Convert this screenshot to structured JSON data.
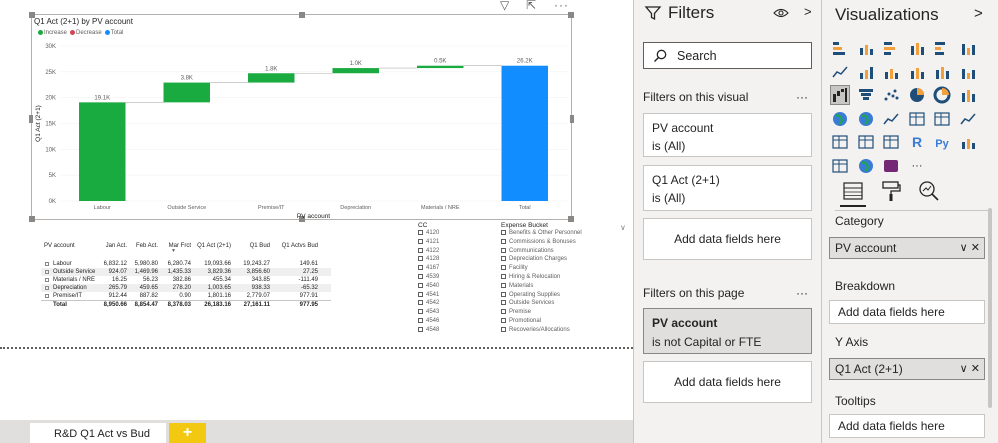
{
  "chart_data": {
    "type": "waterfall",
    "title": "Q1 Act (2+1) by PV account",
    "xlabel": "PV account",
    "ylabel": "Q1 Act (2+1)",
    "ylim": [
      0,
      30000
    ],
    "yticks": [
      "0K",
      "5K",
      "10K",
      "15K",
      "20K",
      "25K",
      "30K"
    ],
    "categories": [
      "Labour",
      "Outside Service",
      "Premise/IT",
      "Depreciation",
      "Materials / NRE",
      "Total"
    ],
    "values": [
      19093.66,
      3829.36,
      1801.16,
      1003.65,
      455.34,
      26183.16
    ],
    "data_labels": [
      "19.1K",
      "3.8K",
      "1.8K",
      "1.0K",
      "0.5K",
      "26.2K"
    ],
    "legend": [
      {
        "name": "Increase",
        "color": "#1aab40"
      },
      {
        "name": "Decrease",
        "color": "#d64554"
      },
      {
        "name": "Total",
        "color": "#118dff"
      }
    ],
    "legend_position": "top-left",
    "grid": true
  },
  "table": {
    "headers": [
      "PV account",
      "Jan Act.",
      "Feb Act.",
      "Mar Frct",
      "Q1 Act (2+1)",
      "Q1 Bud",
      "Q1 Actvs Bud"
    ],
    "rows": [
      {
        "label": "Labour",
        "cells": [
          "6,832.12",
          "5,980.80",
          "6,280.74",
          "19,093.66",
          "19,243.27",
          "149.61"
        ]
      },
      {
        "label": "Outside Service",
        "cells": [
          "924.07",
          "1,469.96",
          "1,435.33",
          "3,829.36",
          "3,856.60",
          "27.25"
        ]
      },
      {
        "label": "Materials / NRE",
        "cells": [
          "16.25",
          "56.23",
          "382.86",
          "455.34",
          "343.85",
          "-111.49"
        ]
      },
      {
        "label": "Depreciation",
        "cells": [
          "265.79",
          "459.65",
          "278.20",
          "1,003.65",
          "938.33",
          "-65.32"
        ]
      },
      {
        "label": "Premise/IT",
        "cells": [
          "912.44",
          "887.82",
          "0.90",
          "1,801.16",
          "2,779.07",
          "977.91"
        ]
      }
    ],
    "total": {
      "label": "Total",
      "cells": [
        "8,950.66",
        "8,854.47",
        "8,378.03",
        "26,183.16",
        "27,161.11",
        "977.95"
      ]
    }
  },
  "slicer_cc": {
    "title": "CC",
    "items": [
      "4120",
      "4121",
      "4122",
      "4128",
      "4167",
      "4539",
      "4540",
      "4541",
      "4542",
      "4543",
      "4546",
      "4548"
    ]
  },
  "slicer_expense": {
    "title": "Expense Bucket",
    "items": [
      "Benefits & Other Personnel",
      "Commissions & Bonuses",
      "Communications",
      "Depreciation Charges",
      "Facility",
      "Hiring & Relocation",
      "Materials",
      "Operating Supplies",
      "Outside Services",
      "Premise",
      "Promotional",
      "Recoveries/Allocations"
    ]
  },
  "tabs": {
    "page_tab": "R&D Q1 Act vs Bud",
    "add_label": "+"
  },
  "filters": {
    "title": "Filters",
    "search_placeholder": "Search",
    "section_visual": "Filters on this visual",
    "section_page": "Filters on this page",
    "more": "···",
    "visual_filters": [
      {
        "name": "PV account",
        "value": "is (All)"
      },
      {
        "name": "Q1 Act (2+1)",
        "value": "is (All)"
      }
    ],
    "page_filters": [
      {
        "name": "PV account",
        "value": "is not Capital or FTE"
      }
    ],
    "add_fields": "Add data fields here"
  },
  "visualizations": {
    "title": "Visualizations",
    "chevron": ">",
    "more_visuals": "···",
    "wells": [
      {
        "label": "Category",
        "field": "PV account"
      },
      {
        "label": "Breakdown",
        "add": "Add data fields here"
      },
      {
        "label": "Y Axis",
        "field": "Q1 Act (2+1)"
      },
      {
        "label": "Tooltips",
        "add": "Add data fields here"
      }
    ]
  },
  "colors": {
    "increase": "#1aab40",
    "decrease": "#d64554",
    "total": "#118dff",
    "accent": "#f2c811"
  }
}
